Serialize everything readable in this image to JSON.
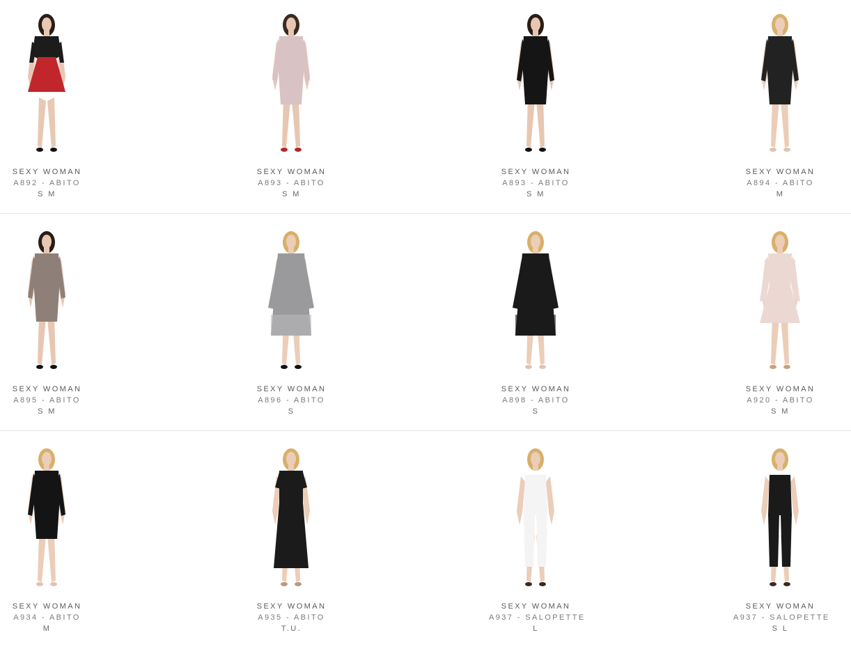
{
  "products": [
    {
      "brand": "SEXY WOMAN",
      "code": "A892 - ABITO",
      "sizes": "S M",
      "style": "dress-two-tone",
      "colors": {
        "top": "#1c1c1c",
        "bottom": "#c0262b",
        "skin": "#e8c8b3",
        "hair": "#2a1d17",
        "shoes": "#111111"
      }
    },
    {
      "brand": "SEXY WOMAN",
      "code": "A893 - ABITO",
      "sizes": "S M",
      "style": "dress-fitted",
      "colors": {
        "top": "#d9c2c3",
        "bottom": "#d9c2c3",
        "skin": "#e7c7b2",
        "hair": "#3a2a22",
        "shoes": "#b3262b"
      }
    },
    {
      "brand": "SEXY WOMAN",
      "code": "A893 - ABITO",
      "sizes": "S M",
      "style": "dress-fitted",
      "colors": {
        "top": "#151515",
        "bottom": "#151515",
        "skin": "#e7c7b2",
        "hair": "#2a1d17",
        "shoes": "#111111"
      }
    },
    {
      "brand": "SEXY WOMAN",
      "code": "A894 - ABITO",
      "sizes": "M",
      "style": "dress-fitted",
      "colors": {
        "top": "#222222",
        "bottom": "#222222",
        "skin": "#ebcdb8",
        "hair": "#d8b06a",
        "shoes": "#e2c3ae"
      }
    },
    {
      "brand": "SEXY WOMAN",
      "code": "A895 - ABITO",
      "sizes": "S M",
      "style": "dress-fitted",
      "colors": {
        "top": "#8e8078",
        "bottom": "#8e8078",
        "skin": "#e7c7b2",
        "hair": "#2a1d17",
        "shoes": "#111111"
      }
    },
    {
      "brand": "SEXY WOMAN",
      "code": "A896 - ABITO",
      "sizes": "S",
      "style": "dress-loose",
      "colors": {
        "top": "#9a9a9c",
        "bottom": "#b9b9bb",
        "skin": "#ebcdb8",
        "hair": "#d8b06a",
        "shoes": "#111111"
      }
    },
    {
      "brand": "SEXY WOMAN",
      "code": "A898 - ABITO",
      "sizes": "S",
      "style": "dress-loose",
      "colors": {
        "top": "#1a1a1a",
        "bottom": "#1a1a1a",
        "skin": "#ebcdb8",
        "hair": "#d8b06a",
        "shoes": "#e2c3ae"
      }
    },
    {
      "brand": "SEXY WOMAN",
      "code": "A920 - ABITO",
      "sizes": "S M",
      "style": "dress-flare",
      "colors": {
        "top": "#ecd8d2",
        "bottom": "#ecd8d2",
        "skin": "#ebcdb8",
        "hair": "#d8b06a",
        "shoes": "#c9a27a"
      }
    },
    {
      "brand": "SEXY WOMAN",
      "code": "A934 - ABITO",
      "sizes": "M",
      "style": "dress-fitted",
      "colors": {
        "top": "#141414",
        "bottom": "#141414",
        "skin": "#ebcdb8",
        "hair": "#d8b06a",
        "shoes": "#e2c3ae"
      }
    },
    {
      "brand": "SEXY WOMAN",
      "code": "A935 - ABITO",
      "sizes": "T.U.",
      "style": "dress-long",
      "colors": {
        "top": "#1b1b1b",
        "bottom": "#1b1b1b",
        "skin": "#ebcdb8",
        "hair": "#d8b06a",
        "shoes": "#b59a82"
      }
    },
    {
      "brand": "SEXY WOMAN",
      "code": "A937 - SALOPETTE",
      "sizes": "L",
      "style": "jumpsuit",
      "colors": {
        "top": "#f4f4f4",
        "bottom": "#f4f4f4",
        "skin": "#ebcdb8",
        "hair": "#d8b06a",
        "shoes": "#3a2a22"
      }
    },
    {
      "brand": "SEXY WOMAN",
      "code": "A937 - SALOPETTE",
      "sizes": "S L",
      "style": "jumpsuit",
      "colors": {
        "top": "#1a1a1a",
        "bottom": "#1a1a1a",
        "skin": "#ebcdb8",
        "hair": "#d8b06a",
        "shoes": "#3a2a22"
      }
    }
  ]
}
